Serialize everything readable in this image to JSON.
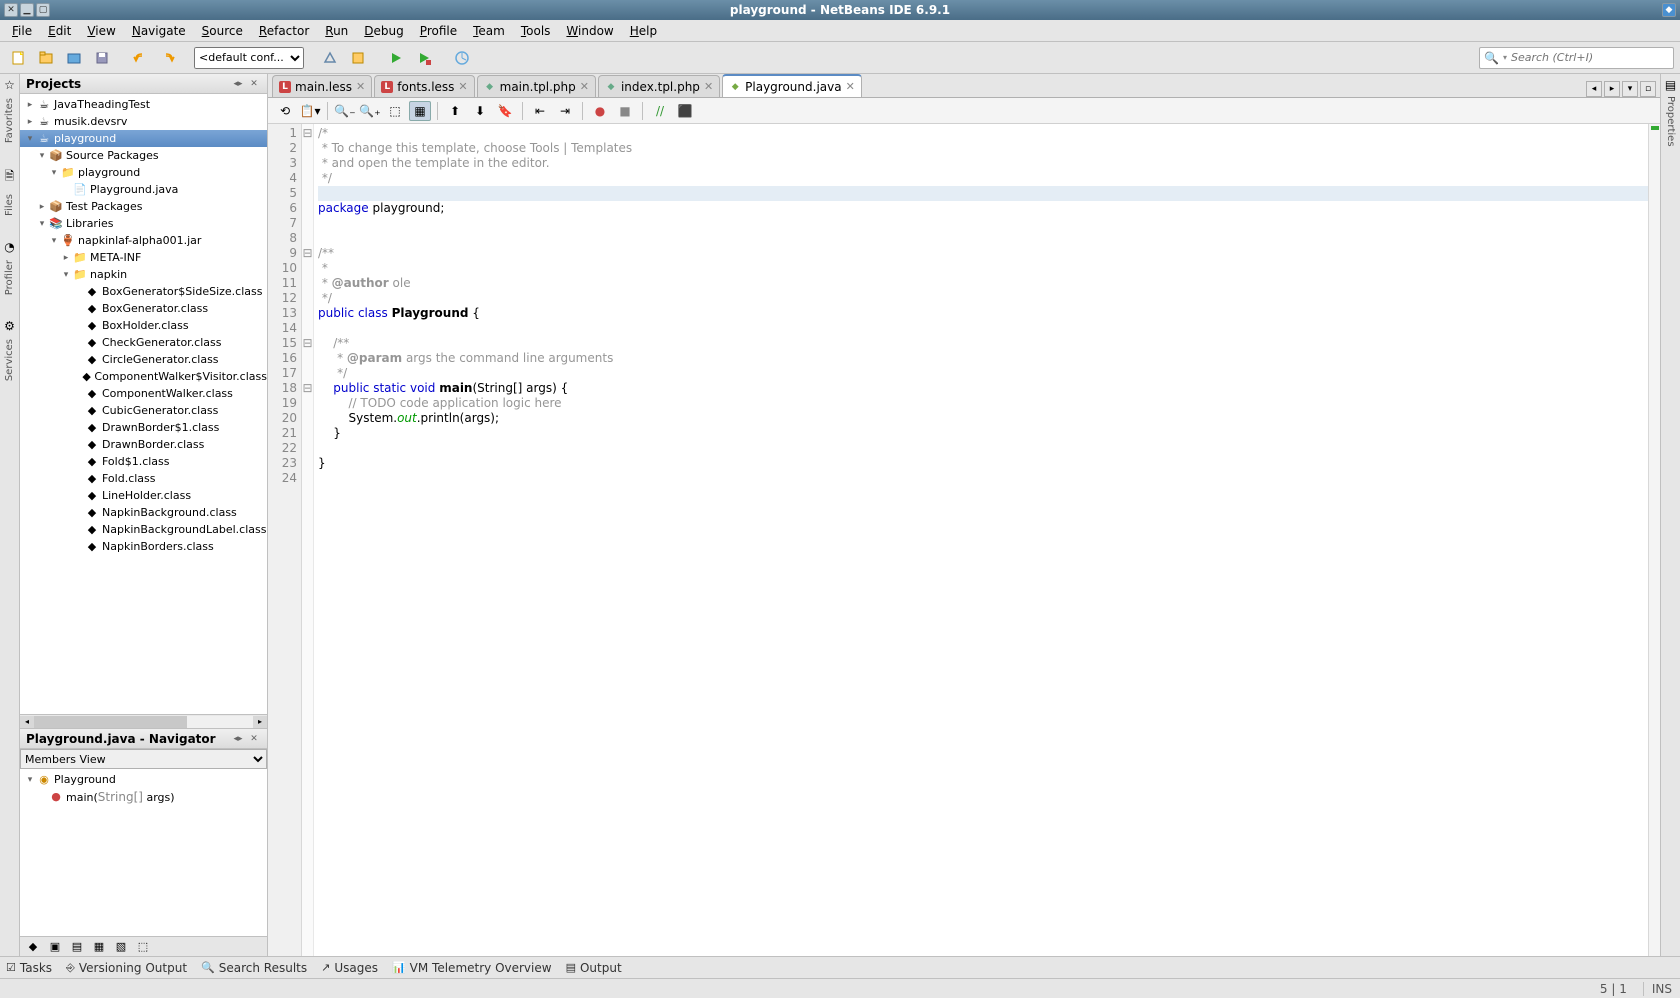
{
  "window": {
    "title": "playground - NetBeans IDE 6.9.1"
  },
  "menu": [
    "File",
    "Edit",
    "View",
    "Navigate",
    "Source",
    "Refactor",
    "Run",
    "Debug",
    "Profile",
    "Team",
    "Tools",
    "Window",
    "Help"
  ],
  "toolbar": {
    "config_select": "<default conf...",
    "search_placeholder": "Search (Ctrl+I)"
  },
  "leftrail": [
    {
      "label": "Favorites",
      "icon": "☆"
    },
    {
      "label": "Files",
      "icon": "🗎"
    },
    {
      "label": "Profiler",
      "icon": "◔"
    },
    {
      "label": "Services",
      "icon": "⚙"
    }
  ],
  "rightrail": [
    {
      "label": "Properties",
      "icon": "▤"
    }
  ],
  "projects": {
    "title": "Projects",
    "tree": [
      {
        "d": 0,
        "tw": "▸",
        "ic": "☕",
        "lbl": "JavaTheadingTest"
      },
      {
        "d": 0,
        "tw": "▸",
        "ic": "☕",
        "lbl": "musik.devsrv"
      },
      {
        "d": 0,
        "tw": "▾",
        "ic": "☕",
        "lbl": "playground",
        "sel": true
      },
      {
        "d": 1,
        "tw": "▾",
        "ic": "📦",
        "lbl": "Source Packages"
      },
      {
        "d": 2,
        "tw": "▾",
        "ic": "📁",
        "lbl": "playground"
      },
      {
        "d": 3,
        "tw": "",
        "ic": "📄",
        "lbl": "Playground.java"
      },
      {
        "d": 1,
        "tw": "▸",
        "ic": "📦",
        "lbl": "Test Packages"
      },
      {
        "d": 1,
        "tw": "▾",
        "ic": "📚",
        "lbl": "Libraries"
      },
      {
        "d": 2,
        "tw": "▾",
        "ic": "🏺",
        "lbl": "napkinlaf-alpha001.jar"
      },
      {
        "d": 3,
        "tw": "▸",
        "ic": "📁",
        "lbl": "META-INF"
      },
      {
        "d": 3,
        "tw": "▾",
        "ic": "📁",
        "lbl": "napkin"
      },
      {
        "d": 4,
        "tw": "",
        "ic": "◆",
        "lbl": "BoxGenerator$SideSize.class"
      },
      {
        "d": 4,
        "tw": "",
        "ic": "◆",
        "lbl": "BoxGenerator.class"
      },
      {
        "d": 4,
        "tw": "",
        "ic": "◆",
        "lbl": "BoxHolder.class"
      },
      {
        "d": 4,
        "tw": "",
        "ic": "◆",
        "lbl": "CheckGenerator.class"
      },
      {
        "d": 4,
        "tw": "",
        "ic": "◆",
        "lbl": "CircleGenerator.class"
      },
      {
        "d": 4,
        "tw": "",
        "ic": "◆",
        "lbl": "ComponentWalker$Visitor.class"
      },
      {
        "d": 4,
        "tw": "",
        "ic": "◆",
        "lbl": "ComponentWalker.class"
      },
      {
        "d": 4,
        "tw": "",
        "ic": "◆",
        "lbl": "CubicGenerator.class"
      },
      {
        "d": 4,
        "tw": "",
        "ic": "◆",
        "lbl": "DrawnBorder$1.class"
      },
      {
        "d": 4,
        "tw": "",
        "ic": "◆",
        "lbl": "DrawnBorder.class"
      },
      {
        "d": 4,
        "tw": "",
        "ic": "◆",
        "lbl": "Fold$1.class"
      },
      {
        "d": 4,
        "tw": "",
        "ic": "◆",
        "lbl": "Fold.class"
      },
      {
        "d": 4,
        "tw": "",
        "ic": "◆",
        "lbl": "LineHolder.class"
      },
      {
        "d": 4,
        "tw": "",
        "ic": "◆",
        "lbl": "NapkinBackground.class"
      },
      {
        "d": 4,
        "tw": "",
        "ic": "◆",
        "lbl": "NapkinBackgroundLabel.class"
      },
      {
        "d": 4,
        "tw": "",
        "ic": "◆",
        "lbl": "NapkinBorders.class"
      }
    ]
  },
  "navigator": {
    "title": "Playground.java - Navigator",
    "view": "Members View",
    "tree": [
      {
        "d": 0,
        "tw": "▾",
        "ic": "◉",
        "lbl": "Playground"
      },
      {
        "d": 1,
        "tw": "",
        "ic": "●",
        "lbl_html": "main(<span style='color:#888'>String[]</span> args)"
      }
    ]
  },
  "tabs": [
    {
      "name": "main.less",
      "icon": "red",
      "label": "L"
    },
    {
      "name": "fonts.less",
      "icon": "red",
      "label": "L"
    },
    {
      "name": "main.tpl.php",
      "icon": "php",
      "label": "◆"
    },
    {
      "name": "index.tpl.php",
      "icon": "php",
      "label": "◆"
    },
    {
      "name": "Playground.java",
      "icon": "java",
      "label": "◆",
      "active": true
    }
  ],
  "code": {
    "lines": [
      {
        "n": 1,
        "f": "⊟",
        "html": "<span class='cm'>/*</span>"
      },
      {
        "n": 2,
        "html": "<span class='cm'> * To change this template, choose Tools | Templates</span>"
      },
      {
        "n": 3,
        "html": "<span class='cm'> * and open the template in the editor.</span>"
      },
      {
        "n": 4,
        "html": "<span class='cm'> */</span>"
      },
      {
        "n": 5,
        "hl": true,
        "html": ""
      },
      {
        "n": 6,
        "html": "<span class='kw'>package</span> playground;"
      },
      {
        "n": 7,
        "html": ""
      },
      {
        "n": 8,
        "html": ""
      },
      {
        "n": 9,
        "f": "⊟",
        "html": "<span class='doc'>/**</span>"
      },
      {
        "n": 10,
        "html": "<span class='doc'> *</span>"
      },
      {
        "n": 11,
        "html": "<span class='doc'> * <span class='tag'>@author</span> ole</span>"
      },
      {
        "n": 12,
        "html": "<span class='doc'> */</span>"
      },
      {
        "n": 13,
        "html": "<span class='kw'>public</span> <span class='kw'>class</span> <span class='cls'>Playground</span> {"
      },
      {
        "n": 14,
        "html": ""
      },
      {
        "n": 15,
        "f": "⊟",
        "html": "    <span class='doc'>/**</span>"
      },
      {
        "n": 16,
        "html": "    <span class='doc'> * <span class='tag'>@param</span> args the command line arguments</span>"
      },
      {
        "n": 17,
        "html": "    <span class='doc'> */</span>"
      },
      {
        "n": 18,
        "f": "⊟",
        "html": "    <span class='kw'>public</span> <span class='kw'>static</span> <span class='kw'>void</span> <span class='fn'>main</span>(String[] args) {"
      },
      {
        "n": 19,
        "html": "        <span class='cm'>// TODO code application logic here</span>"
      },
      {
        "n": 20,
        "html": "        System.<span class='fld'>out</span>.println(args);"
      },
      {
        "n": 21,
        "html": "    }"
      },
      {
        "n": 22,
        "html": ""
      },
      {
        "n": 23,
        "html": "}"
      },
      {
        "n": 24,
        "html": ""
      }
    ]
  },
  "bottom_tabs": [
    {
      "icon": "☑",
      "label": "Tasks"
    },
    {
      "icon": "⎆",
      "label": "Versioning Output"
    },
    {
      "icon": "🔍",
      "label": "Search Results"
    },
    {
      "icon": "↗",
      "label": "Usages"
    },
    {
      "icon": "📊",
      "label": "VM Telemetry Overview"
    },
    {
      "icon": "▤",
      "label": "Output"
    }
  ],
  "status": {
    "pos": "5 | 1",
    "mode": "INS"
  }
}
